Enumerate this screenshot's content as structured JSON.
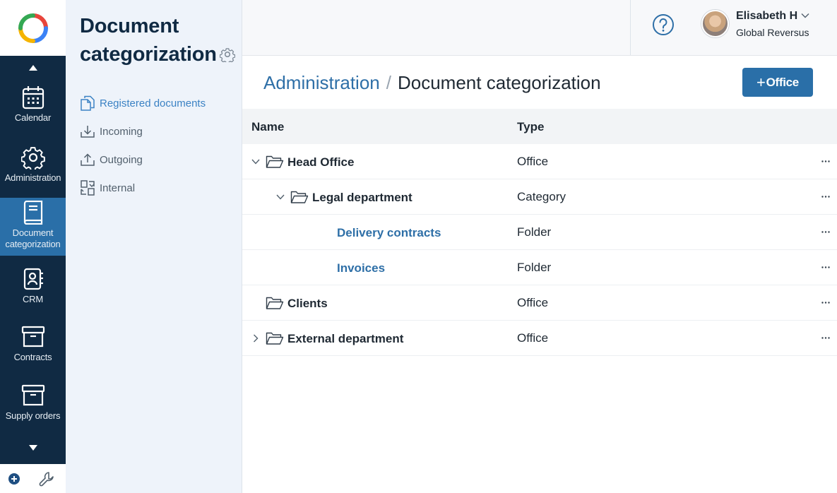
{
  "colors": {
    "rail_bg": "#102a43",
    "rail_active": "#2a6fa8",
    "accent": "#2e6fa7",
    "subnav_bg": "#eef3fa"
  },
  "rail": {
    "items": [
      {
        "label": "Calendar",
        "icon": "calendar-icon"
      },
      {
        "label": "Administration",
        "icon": "gear-icon"
      },
      {
        "label": "Document categorization",
        "icon": "book-icon",
        "active": true
      },
      {
        "label": "CRM",
        "icon": "contact-icon"
      },
      {
        "label": "Contracts",
        "icon": "archive-box-icon"
      },
      {
        "label": "Supply orders",
        "icon": "archive-box-icon"
      }
    ]
  },
  "subnav": {
    "title": "Document categorization",
    "items": [
      {
        "label": "Registered documents",
        "icon": "documents-icon",
        "active": true
      },
      {
        "label": "Incoming",
        "icon": "download-tray-icon"
      },
      {
        "label": "Outgoing",
        "icon": "upload-tray-icon"
      },
      {
        "label": "Internal",
        "icon": "swap-icon"
      }
    ]
  },
  "header": {
    "user_name": "Elisabeth H",
    "user_company": "Global Reversus"
  },
  "page": {
    "breadcrumb_parent": "Administration",
    "breadcrumb_separator": "/",
    "title": "Document categorization",
    "add_button_plus": "+",
    "add_button_label": "Office"
  },
  "table": {
    "columns": [
      "Name",
      "Type"
    ],
    "rows": [
      {
        "name": "Head Office",
        "type": "Office",
        "level": 0,
        "toggle": "expanded",
        "folder": true,
        "link": false
      },
      {
        "name": "Legal department",
        "type": "Category",
        "level": 1,
        "toggle": "expanded",
        "folder": true,
        "link": false
      },
      {
        "name": "Delivery contracts",
        "type": "Folder",
        "level": 2,
        "toggle": "none",
        "folder": false,
        "link": true
      },
      {
        "name": "Invoices",
        "type": "Folder",
        "level": 2,
        "toggle": "none",
        "folder": false,
        "link": true
      },
      {
        "name": "Clients",
        "type": "Office",
        "level": 0,
        "toggle": "none",
        "folder": true,
        "link": false
      },
      {
        "name": "External department",
        "type": "Office",
        "level": 0,
        "toggle": "collapsed",
        "folder": true,
        "link": false
      }
    ],
    "row_action_icon": "more-horizontal-icon"
  }
}
